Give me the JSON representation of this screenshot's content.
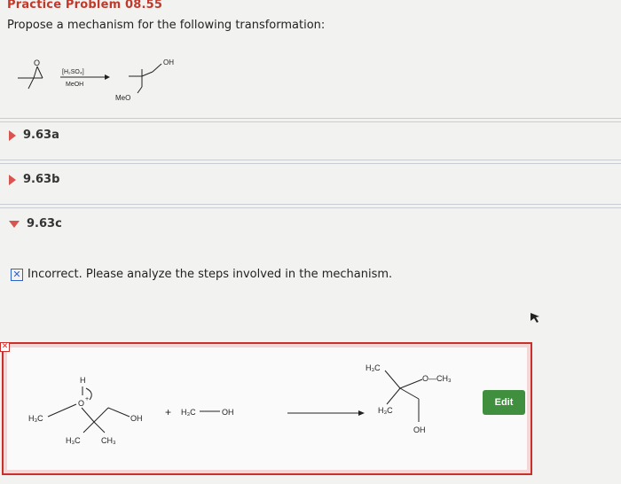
{
  "header": {
    "title": "Practice Problem 08.55",
    "prompt": "Propose a mechanism for the following transformation:"
  },
  "reaction": {
    "reagent_top": "[H₂SO₄]",
    "reagent_bottom": "MeOH",
    "product_oh": "OH",
    "product_meo": "MeO",
    "reactant_o": "O"
  },
  "sections": [
    {
      "label": "9.63a",
      "state": "collapsed"
    },
    {
      "label": "9.63b",
      "state": "collapsed"
    },
    {
      "label": "9.63c",
      "state": "expanded"
    }
  ],
  "feedback": {
    "icon": "x-icon",
    "text": "Incorrect. Please analyze the steps involved in the mechanism."
  },
  "mechanism": {
    "left": {
      "h": "H",
      "o_plus": "O",
      "h3c_left": "H₃C",
      "oh": "OH",
      "h3c_bottom": "H₃C",
      "ch3_bottom": "CH₃"
    },
    "plus_sign": "+",
    "methanol": {
      "h3c": "H₃C",
      "oh": "OH"
    },
    "right": {
      "h3c_top": "H₃C",
      "o_ch3": "O—CH₃",
      "h3c_mid": "H₃C",
      "oh": "OH"
    },
    "edit_label": "Edit"
  },
  "colors": {
    "title": "#c0392b",
    "marker": "#d9534f",
    "panel_border": "#c9302c",
    "edit_button": "#3f8f3f",
    "feedback_icon": "#2d62c8"
  }
}
